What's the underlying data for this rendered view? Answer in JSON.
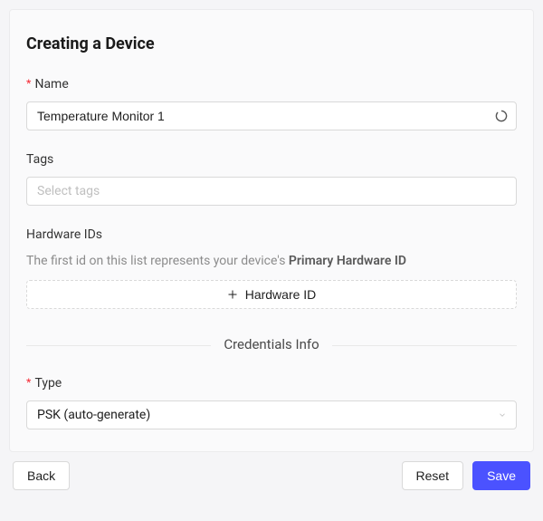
{
  "header": {
    "title": "Creating a Device"
  },
  "form": {
    "name": {
      "label": "Name",
      "value": "Temperature Monitor 1"
    },
    "tags": {
      "label": "Tags",
      "placeholder": "Select tags"
    },
    "hardware_ids": {
      "label": "Hardware IDs",
      "helper_prefix": "The first id on this list represents your device's ",
      "helper_strong": "Primary Hardware ID",
      "add_button": "Hardware ID"
    },
    "divider": {
      "text": "Credentials Info"
    },
    "type": {
      "label": "Type",
      "selected": "PSK (auto-generate)"
    }
  },
  "actions": {
    "back": "Back",
    "reset": "Reset",
    "save": "Save"
  }
}
